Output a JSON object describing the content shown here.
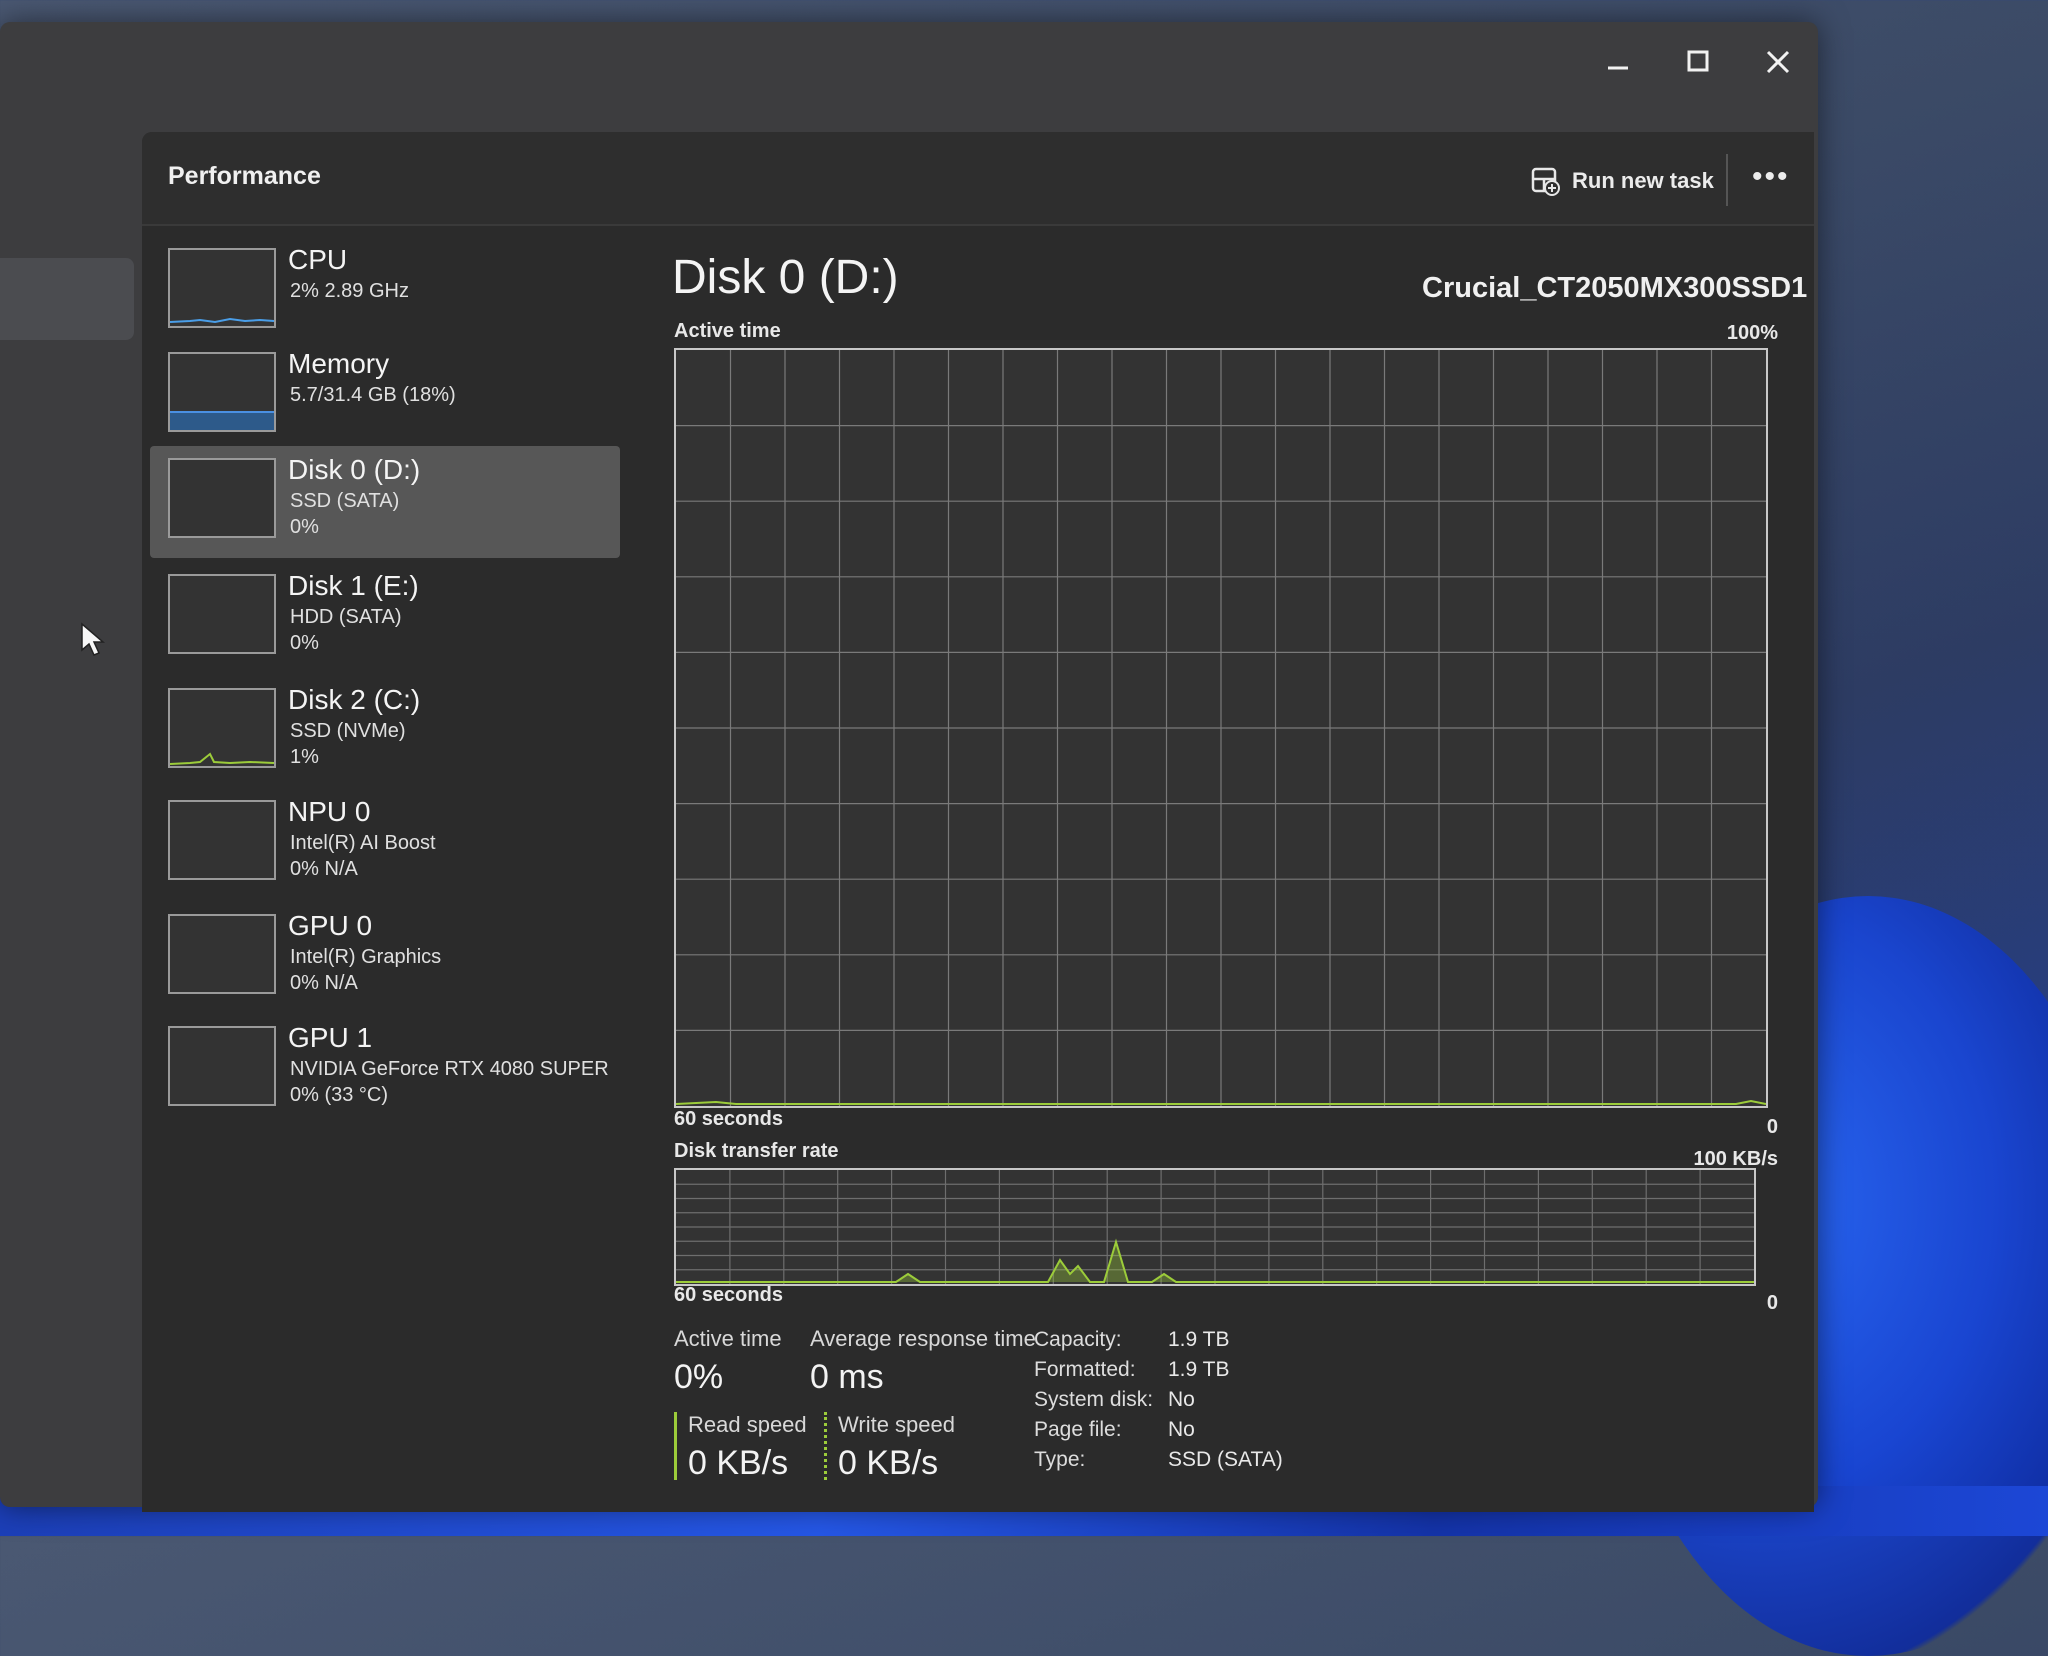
{
  "window": {
    "minimize_icon": "minimize-icon",
    "maximize_icon": "maximize-icon",
    "close_icon": "close-icon"
  },
  "header": {
    "title": "Performance",
    "run_new_task": "Run new task",
    "more_icon": "more-icon"
  },
  "sidebar": {
    "items": [
      {
        "title": "CPU",
        "line1": "2% 2.89 GHz",
        "line2": ""
      },
      {
        "title": "Memory",
        "line1": "5.7/31.4 GB (18%)",
        "line2": ""
      },
      {
        "title": "Disk 0 (D:)",
        "line1": "SSD (SATA)",
        "line2": "0%"
      },
      {
        "title": "Disk 1 (E:)",
        "line1": "HDD (SATA)",
        "line2": "0%"
      },
      {
        "title": "Disk 2 (C:)",
        "line1": "SSD (NVMe)",
        "line2": "1%"
      },
      {
        "title": "NPU 0",
        "line1": "Intel(R) AI Boost",
        "line2": "0% N/A"
      },
      {
        "title": "GPU 0",
        "line1": "Intel(R) Graphics",
        "line2": "0% N/A"
      },
      {
        "title": "GPU 1",
        "line1": "NVIDIA GeForce RTX 4080 SUPER",
        "line2": "0% (33 °C)"
      }
    ],
    "selected_index": 2
  },
  "main": {
    "disk_title": "Disk 0 (D:)",
    "model": "Crucial_CT2050MX300SSD1",
    "active_chart": {
      "label": "Active time",
      "max_label": "100%",
      "time_label": "60 seconds",
      "min_label": "0"
    },
    "transfer_chart": {
      "label": "Disk transfer rate",
      "max_label": "100 KB/s",
      "time_label": "60 seconds",
      "min_label": "0"
    },
    "stats": {
      "active_time_label": "Active time",
      "active_time_value": "0%",
      "avg_response_label": "Average response time",
      "avg_response_value": "0 ms",
      "read_speed_label": "Read speed",
      "read_speed_value": "0 KB/s",
      "write_speed_label": "Write speed",
      "write_speed_value": "0 KB/s"
    },
    "properties": [
      {
        "key": "Capacity:",
        "value": "1.9 TB"
      },
      {
        "key": "Formatted:",
        "value": "1.9 TB"
      },
      {
        "key": "System disk:",
        "value": "No"
      },
      {
        "key": "Page file:",
        "value": "No"
      },
      {
        "key": "Type:",
        "value": "SSD (SATA)"
      }
    ]
  },
  "colors": {
    "disk_line": "#9ccc3a",
    "memory_line": "#4a90e2",
    "cpu_line": "#4a9ee8"
  }
}
